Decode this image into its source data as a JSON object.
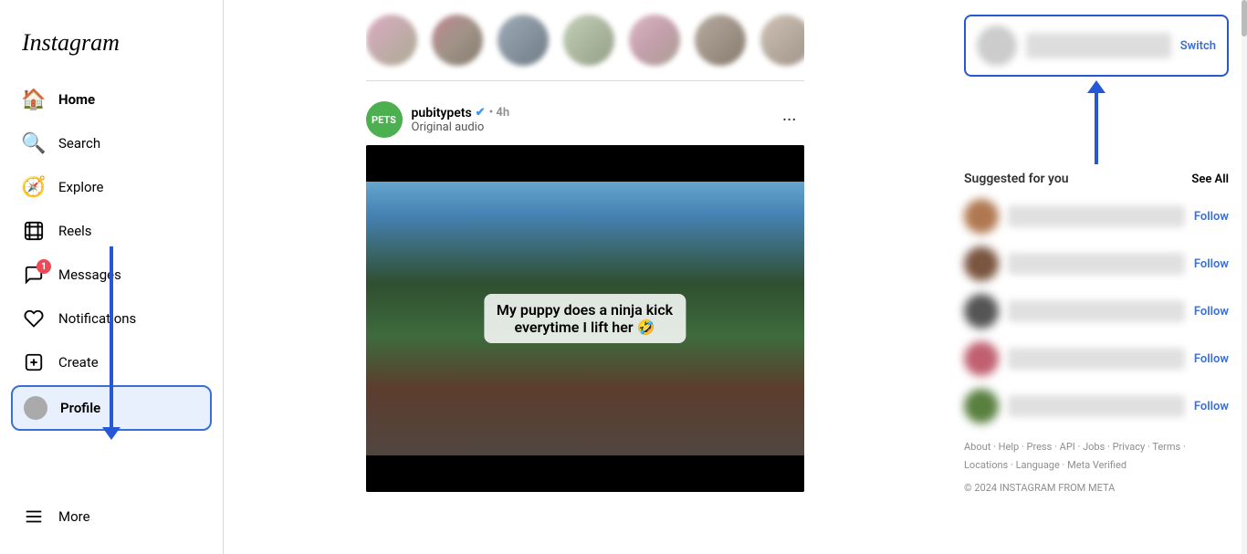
{
  "sidebar": {
    "logo": "Instagram",
    "items": [
      {
        "id": "home",
        "label": "Home",
        "icon": "🏠",
        "active": true
      },
      {
        "id": "search",
        "label": "Search",
        "icon": "🔍"
      },
      {
        "id": "explore",
        "label": "Explore",
        "icon": "🧭"
      },
      {
        "id": "reels",
        "label": "Reels",
        "icon": "📽"
      },
      {
        "id": "messages",
        "label": "Messages",
        "icon": "✉",
        "badge": "1"
      },
      {
        "id": "notifications",
        "label": "Notifications",
        "icon": "♡"
      },
      {
        "id": "create",
        "label": "Create",
        "icon": "➕"
      },
      {
        "id": "profile",
        "label": "Profile",
        "icon": "avatar",
        "highlighted": true
      }
    ],
    "more_label": "More"
  },
  "post": {
    "username": "pubitypets",
    "verified": true,
    "time": "4h",
    "subtitle": "Original audio",
    "overlay_text": "My puppy does a ninja kick\neverytime I lift her 🤣",
    "dots": "···"
  },
  "right_panel": {
    "switch_label": "Switch",
    "suggested_title": "Suggested for you",
    "see_all_label": "See All",
    "follow_labels": [
      "Follow",
      "Follow",
      "Follow",
      "Follow",
      "Follow"
    ]
  },
  "footer": {
    "links": [
      "About",
      "Help",
      "Press",
      "API",
      "Jobs",
      "Privacy",
      "Terms",
      "Locations",
      "Language",
      "Meta Verified"
    ],
    "copyright": "© 2024 INSTAGRAM FROM META"
  }
}
